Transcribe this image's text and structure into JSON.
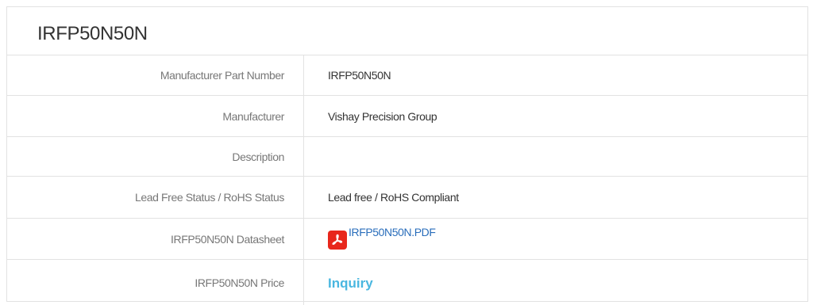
{
  "title": "IRFP50N50N",
  "rows": [
    {
      "label": "Manufacturer Part Number",
      "value": "IRFP50N50N"
    },
    {
      "label": "Manufacturer",
      "value": "Vishay Precision Group"
    },
    {
      "label": "Description",
      "value": ""
    },
    {
      "label": "Lead Free Status / RoHS Status",
      "value": "Lead free / RoHS Compliant"
    },
    {
      "label": "IRFP50N50N Datasheet",
      "link_text": "IRFP50N50N.PDF",
      "icon": "pdf-icon"
    },
    {
      "label": "IRFP50N50N Price",
      "link_text": "Inquiry"
    }
  ],
  "colors": {
    "border": "#e2e2e2",
    "label_text": "#777777",
    "value_text": "#333333",
    "datasheet_link": "#2a6ebb",
    "inquiry_link": "#4ab7e0",
    "pdf_icon_bg": "#e8271c"
  }
}
